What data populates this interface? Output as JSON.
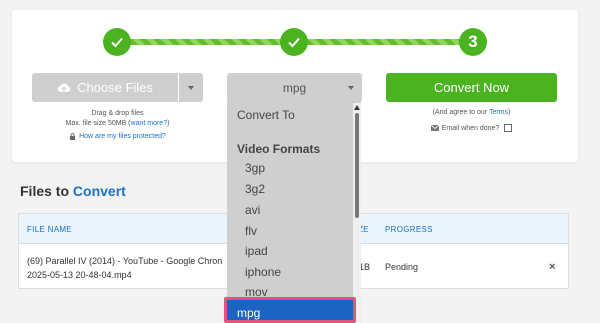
{
  "steps": [
    {
      "label": "",
      "done": true
    },
    {
      "label": "",
      "done": true
    },
    {
      "label": "3",
      "done": false
    }
  ],
  "upload": {
    "choose_label": "Choose Files",
    "drag_text": "Drag & drop files",
    "max_size_prefix": "Max. file size 50MB (",
    "want_more": "want more?",
    "max_size_suffix": ")",
    "protect_link": "How are my files protected?"
  },
  "format_select": {
    "value": "mpg"
  },
  "convert": {
    "button_label": "Convert Now",
    "agree_prefix": "(And agree to our ",
    "terms_link": "Terms",
    "agree_suffix": ")",
    "email_label": "Email when done?"
  },
  "section": {
    "title_part1": "Files to ",
    "title_part2": "Convert"
  },
  "table": {
    "headers": {
      "file_name": "FILE NAME",
      "size": "ZE",
      "progress": "PROGRESS"
    },
    "rows": [
      {
        "name_line1": "(69) Parallel IV (2014) - YouTube - Google Chron",
        "name_line2": "2025-05-13 20-48-04.mp4",
        "size": "1B",
        "progress": "Pending",
        "remove": "×"
      }
    ]
  },
  "dropdown": {
    "convert_to": "Convert To",
    "group": "Video Formats",
    "options": [
      "3gp",
      "3g2",
      "avi",
      "flv",
      "ipad",
      "iphone",
      "mov",
      "mpg"
    ],
    "selected": "mpg"
  },
  "colors": {
    "brand_green": "#4cb320",
    "link_blue": "#1a72c4",
    "highlight_border": "#e0567a",
    "selected_bg": "#1c63c4"
  }
}
